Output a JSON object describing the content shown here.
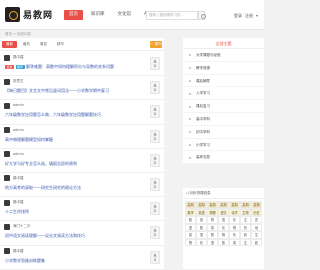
{
  "brand": {
    "name": "易教网"
  },
  "nav": {
    "items": [
      "首页",
      "知识库",
      "文化馆",
      "APP"
    ]
  },
  "search": {
    "placeholder": "搜索 / 搜你想学习的..."
  },
  "login": {
    "login_label": "登录",
    "register_label": "注册"
  },
  "breadcrumb": "首页 > 知识问答",
  "tabs": {
    "items": [
      "最新",
      "最热",
      "悬赏",
      "精华"
    ],
    "ask_label": "+ 提问"
  },
  "posts": [
    {
      "user": "路中建",
      "badge": "最新",
      "tag": "推荐",
      "title": "解答难题：高数中如何理解积分与导数的关系问题",
      "likes": "0"
    },
    {
      "user": "张思文",
      "badge": "",
      "tag": "",
      "title": "【每日题目】文言文中常见虚词用法——小学数学期中复习",
      "likes": "0"
    },
    {
      "user": "admin",
      "badge": "",
      "tag": "",
      "title": "六年级数学应用题怎么做，六年级数学应用题解题技巧",
      "likes": "0"
    },
    {
      "user": "admin",
      "badge": "",
      "tag": "",
      "title": "高中物理解题模型如何掌握",
      "likes": "0"
    },
    {
      "user": "admin",
      "badge": "",
      "tag": "",
      "title": "好大学与好专业怎么选，填报志愿的原则",
      "likes": "0"
    },
    {
      "user": "路中建",
      "badge": "",
      "tag": "",
      "title": "地方高考的录取——研究生研究的理论方法",
      "likes": "0"
    },
    {
      "user": "路中建",
      "badge": "",
      "tag": "",
      "title": "十二生肖排序",
      "likes": "0"
    },
    {
      "user": "海门十二中",
      "badge": "",
      "tag": "",
      "title": "初中语文阅读理解——议论文阅读方法和技巧",
      "likes": "0"
    },
    {
      "user": "路中建",
      "badge": "",
      "tag": "",
      "title": "小学数学思维训练题集",
      "likes": "0"
    }
  ],
  "sidebar": {
    "title": "全部主题",
    "items": [
      "大学课程与经验",
      "教学资源",
      "课后辅导",
      "入学学习",
      "课后复习",
      "高中学科",
      "初中学科",
      "小学学习",
      "高考志愿"
    ]
  },
  "calendar": {
    "title": "八月份排课信息",
    "headers": [
      "星期一",
      "星期二",
      "星期三",
      "星期四",
      "星期五",
      "星期六",
      "星期日"
    ],
    "row1": [
      "数学",
      "英语",
      "物理",
      "语文",
      "化学",
      "生物",
      "历史"
    ],
    "row2": [
      "数",
      "英",
      "物",
      "语",
      "化",
      "生",
      "史"
    ],
    "row3": [
      "语",
      "数",
      "英",
      "化",
      "物",
      "历",
      "地"
    ],
    "row4": [
      "英",
      "语",
      "数",
      "物",
      "化",
      "政",
      "生"
    ],
    "row5": [
      "物",
      "化",
      "语",
      "数",
      "英",
      "生",
      "政"
    ]
  },
  "colors": {
    "accent": "#e8514a",
    "link": "#3355aa",
    "orange": "#f0a030"
  }
}
